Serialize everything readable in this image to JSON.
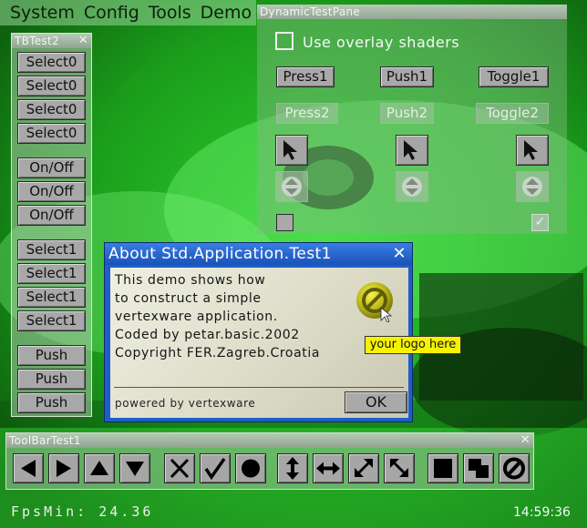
{
  "menubar": {
    "items": [
      "System",
      "Config",
      "Tools",
      "Demo"
    ]
  },
  "tbtest2": {
    "title": "TBTest2",
    "buttons": [
      "Select0",
      "Select0",
      "Select0",
      "Select0",
      "On/Off",
      "On/Off",
      "On/Off",
      "Select1",
      "Select1",
      "Select1",
      "Select1",
      "Push",
      "Push",
      "Push"
    ]
  },
  "dynamic_pane": {
    "title": "DynamicTestPane",
    "overlay_label": "Use overlay shaders",
    "buttons_row1": [
      "Press1",
      "Push1",
      "Toggle1"
    ],
    "buttons_row2": [
      "Press2",
      "Push2",
      "Toggle2"
    ]
  },
  "about": {
    "title": "About  Std.Application.Test1",
    "lines": [
      "This  demo  shows  how",
      "to  construct  a  simple",
      "vertexware  application.",
      "Coded  by  petar.basic.2002",
      "Copyright  FER.Zagreb.Croatia"
    ],
    "logo_caption": "your  logo  here",
    "powered": "powered  by  vertexware",
    "ok_label": "OK"
  },
  "toolbar": {
    "title": "ToolBarTest1",
    "icons": [
      "arrow-left-icon",
      "arrow-right-icon",
      "arrow-up-icon",
      "arrow-down-icon",
      "cross-icon",
      "check-icon",
      "circle-icon",
      "resize-vertical-icon",
      "resize-horizontal-icon",
      "resize-diagonal-ne-icon",
      "resize-diagonal-se-icon",
      "square-icon",
      "cascade-squares-icon",
      "no-entry-icon"
    ]
  },
  "status": {
    "fps": "FpsMin:  24.36",
    "clock": "14:59:36"
  },
  "colors": {
    "background": "#1fa31f",
    "dialog_blue": "#1f5ec8",
    "logo_badge": "#f5f300"
  }
}
